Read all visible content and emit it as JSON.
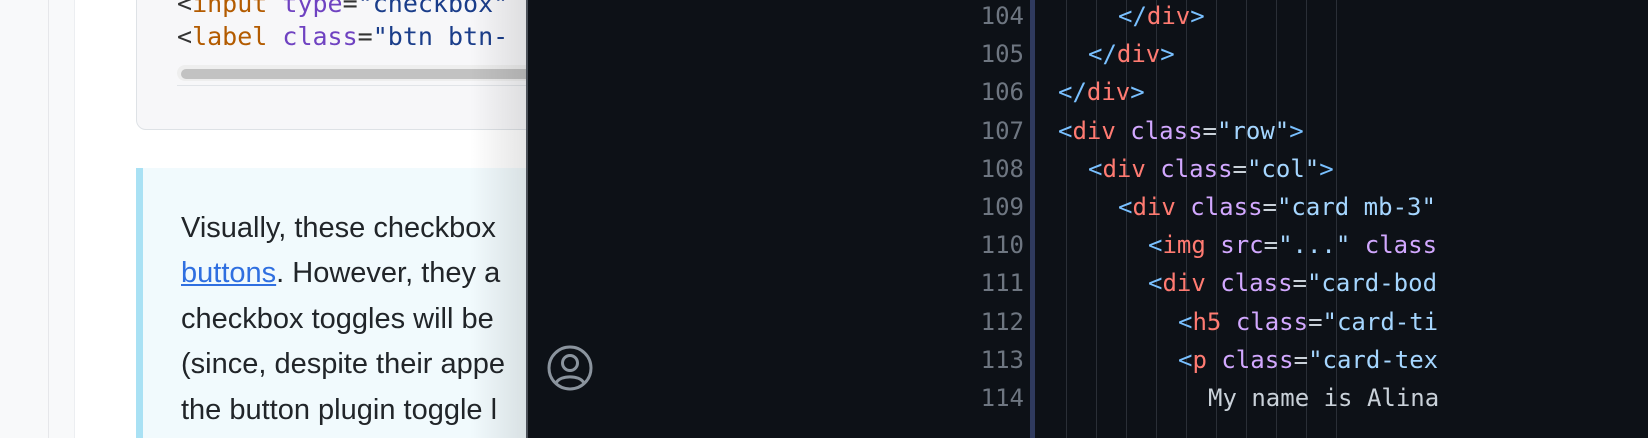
{
  "doc": {
    "snippet": {
      "line1": {
        "open": "<",
        "tag": "input",
        "attr": "type",
        "eq": "=",
        "value": "\"checkbox\""
      },
      "line2": {
        "open": "<",
        "tag": "label",
        "attr": "class",
        "eq": "=",
        "value": "\"btn btn-"
      }
    },
    "callout": {
      "line1": "Visually, these checkbox",
      "line2_link": "buttons",
      "line2_rest": ". However, they a",
      "line3": "checkbox toggles will be",
      "line4": "(since, despite their appe",
      "line5": "the button plugin toggle l"
    }
  },
  "editor": {
    "line_numbers": [
      "104",
      "105",
      "106",
      "107",
      "108",
      "109",
      "110",
      "111",
      "112",
      "113",
      "114"
    ],
    "lines": [
      {
        "indent": 7,
        "parts": [
          [
            "br",
            "</"
          ],
          [
            "tag",
            "div"
          ],
          [
            "br",
            ">"
          ]
        ]
      },
      {
        "indent": 6,
        "parts": [
          [
            "br",
            "</"
          ],
          [
            "tag",
            "div"
          ],
          [
            "br",
            ">"
          ]
        ]
      },
      {
        "indent": 5,
        "parts": [
          [
            "br",
            "</"
          ],
          [
            "tag",
            "div"
          ],
          [
            "br",
            ">"
          ]
        ]
      },
      {
        "indent": 5,
        "parts": [
          [
            "br",
            "<"
          ],
          [
            "tag",
            "div"
          ],
          [
            "text",
            " "
          ],
          [
            "attr",
            "class"
          ],
          [
            "eq",
            "="
          ],
          [
            "str",
            "\"row\""
          ],
          [
            "br",
            ">"
          ]
        ]
      },
      {
        "indent": 6,
        "parts": [
          [
            "br",
            "<"
          ],
          [
            "tag",
            "div"
          ],
          [
            "text",
            " "
          ],
          [
            "attr",
            "class"
          ],
          [
            "eq",
            "="
          ],
          [
            "str",
            "\"col\""
          ],
          [
            "br",
            ">"
          ]
        ]
      },
      {
        "indent": 7,
        "parts": [
          [
            "br",
            "<"
          ],
          [
            "tag",
            "div"
          ],
          [
            "text",
            " "
          ],
          [
            "attr",
            "class"
          ],
          [
            "eq",
            "="
          ],
          [
            "str",
            "\"card mb-3\""
          ]
        ]
      },
      {
        "indent": 8,
        "parts": [
          [
            "br",
            "<"
          ],
          [
            "tag",
            "img"
          ],
          [
            "text",
            " "
          ],
          [
            "attr",
            "src"
          ],
          [
            "eq",
            "="
          ],
          [
            "str",
            "\"...\""
          ],
          [
            "text",
            " "
          ],
          [
            "attr",
            "class"
          ]
        ]
      },
      {
        "indent": 8,
        "parts": [
          [
            "br",
            "<"
          ],
          [
            "tag",
            "div"
          ],
          [
            "text",
            " "
          ],
          [
            "attr",
            "class"
          ],
          [
            "eq",
            "="
          ],
          [
            "str",
            "\"card-bod"
          ]
        ]
      },
      {
        "indent": 9,
        "parts": [
          [
            "br",
            "<"
          ],
          [
            "tag",
            "h5"
          ],
          [
            "text",
            " "
          ],
          [
            "attr",
            "class"
          ],
          [
            "eq",
            "="
          ],
          [
            "str",
            "\"card-ti"
          ]
        ]
      },
      {
        "indent": 9,
        "parts": [
          [
            "br",
            "<"
          ],
          [
            "tag",
            "p"
          ],
          [
            "text",
            " "
          ],
          [
            "attr",
            "class"
          ],
          [
            "eq",
            "="
          ],
          [
            "str",
            "\"card-tex"
          ]
        ]
      },
      {
        "indent": 10,
        "parts": [
          [
            "text",
            "My name is Alina"
          ]
        ]
      }
    ],
    "icons": {
      "account": "account-icon"
    },
    "colors": {
      "background": "#0d1117",
      "tag": "#ff7b72",
      "attr": "#d2a8ff",
      "string": "#a5d6ff",
      "bracket": "#79c0ff"
    }
  }
}
